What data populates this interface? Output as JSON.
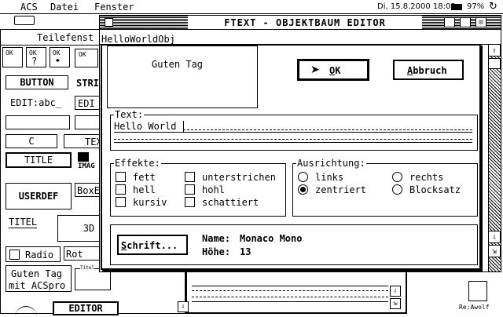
{
  "menubar": {
    "logo": "ACS",
    "menus": [
      "Datei",
      "Fenster"
    ],
    "clock": "Di, 15.8.2000 18:03",
    "battery": "97%"
  },
  "background": {
    "left_window_title": "Teilefenst",
    "left_items": {
      "button": "BUTTON",
      "stri": "STRI",
      "edit": "EDIT:abc_",
      "edit2": "EDI",
      "c": "C",
      "tex": "TEX",
      "title": "TITLE",
      "imag": "IMAG",
      "userdef": "USERDEF",
      "boxe": "BoxE",
      "titel": "TITEL",
      "threed": "3D",
      "radio": "Radio",
      "rot": "Rot",
      "guten_line1": "Guten Tag",
      "guten_line2": "mit ACSpro",
      "titel_small": "Titel",
      "editor": "EDITOR"
    },
    "trash_label": "Re:Awolf"
  },
  "window": {
    "title": "FTEXT - OBJEKTBAUM EDITOR",
    "object_name": "HelloWorldObj"
  },
  "dialog": {
    "preview_text": "Guten Tag",
    "ok_label": "OK",
    "cancel_label": "Abbruch",
    "text_group_label": "Text:",
    "text_value": "Hello World",
    "effects": {
      "label": "Effekte:",
      "items": [
        {
          "label": "fett",
          "checked": false
        },
        {
          "label": "hell",
          "checked": false
        },
        {
          "label": "kursiv",
          "checked": false
        },
        {
          "label": "unterstrichen",
          "checked": false
        },
        {
          "label": "hohl",
          "checked": false
        },
        {
          "label": "schattiert",
          "checked": false
        }
      ]
    },
    "alignment": {
      "label": "Ausrichtung:",
      "items": [
        {
          "label": "links",
          "selected": false
        },
        {
          "label": "zentriert",
          "selected": true
        },
        {
          "label": "rechts",
          "selected": false
        },
        {
          "label": "Blocksatz",
          "selected": false
        }
      ]
    },
    "font_button": "Schrift...",
    "font_name_label": "Name:",
    "font_name": "Monaco Mono",
    "font_height_label": "Höhe:",
    "font_height": "13"
  }
}
